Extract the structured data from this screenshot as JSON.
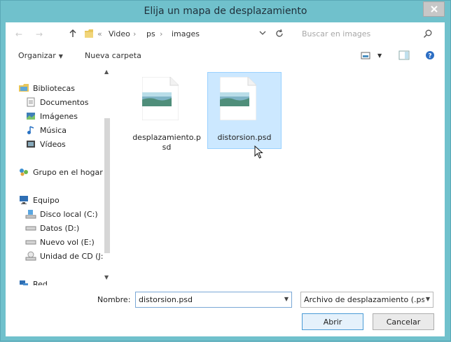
{
  "window": {
    "title": "Elija un mapa de desplazamiento",
    "close_icon": "close-icon"
  },
  "nav": {
    "back_icon": "back-arrow-icon",
    "forward_icon": "forward-arrow-icon",
    "up_icon": "up-arrow-icon",
    "overflow": "«",
    "breadcrumbs": [
      "Video",
      "ps",
      "images"
    ],
    "search_placeholder": "Buscar en images"
  },
  "toolbar": {
    "organize_label": "Organizar",
    "new_folder_label": "Nueva carpeta"
  },
  "sidebar": {
    "items": [
      {
        "label": "Bibliotecas",
        "icon": "libraries-icon"
      },
      {
        "label": "Documentos",
        "icon": "documents-icon"
      },
      {
        "label": "Imágenes",
        "icon": "pictures-icon"
      },
      {
        "label": "Música",
        "icon": "music-icon"
      },
      {
        "label": "Vídeos",
        "icon": "videos-icon"
      },
      {
        "label": "Grupo en el hogar",
        "icon": "homegroup-icon"
      },
      {
        "label": "Equipo",
        "icon": "computer-icon"
      },
      {
        "label": "Disco local (C:)",
        "icon": "local-disk-icon"
      },
      {
        "label": "Datos (D:)",
        "icon": "drive-icon"
      },
      {
        "label": "Nuevo vol (E:)",
        "icon": "drive-icon"
      },
      {
        "label": "Unidad de CD (J:",
        "icon": "cd-drive-icon"
      },
      {
        "label": "Red",
        "icon": "network-icon"
      }
    ]
  },
  "files": [
    {
      "name_line1": "desplazamiento.p",
      "name_line2": "sd",
      "selected": false
    },
    {
      "name_line1": "distorsion.psd",
      "name_line2": "",
      "selected": true
    }
  ],
  "footer": {
    "name_label": "Nombre:",
    "name_value": "distorsion.psd",
    "filter_value": "Archivo de desplazamiento (.ps",
    "open_label": "Abrir",
    "cancel_label": "Cancelar"
  },
  "colors": {
    "title_bar": "#70c1cc",
    "selection": "#cce8ff",
    "selection_border": "#99d1ff"
  }
}
